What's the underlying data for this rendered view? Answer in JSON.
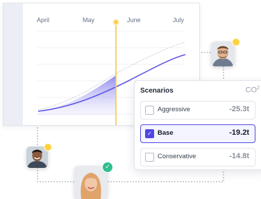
{
  "chart": {
    "months": [
      "April",
      "May",
      "June",
      "July"
    ],
    "marker_month": "May"
  },
  "scenarios": {
    "title": "Scenarios",
    "unit": "CO",
    "unit_sup": "2",
    "rows": [
      {
        "label": "Aggressive",
        "value": "-25.3t",
        "checked": false
      },
      {
        "label": "Base",
        "value": "-19.2t",
        "checked": true
      },
      {
        "label": "Conservative",
        "value": "-14.8t",
        "checked": false
      }
    ]
  },
  "colors": {
    "accent": "#4f46e5",
    "marker": "#ffc53d",
    "badge_dot": "#ffd23f",
    "badge_check": "#2fbf8f"
  },
  "icons": [
    "check-icon",
    "checkbox-checked-icon"
  ]
}
